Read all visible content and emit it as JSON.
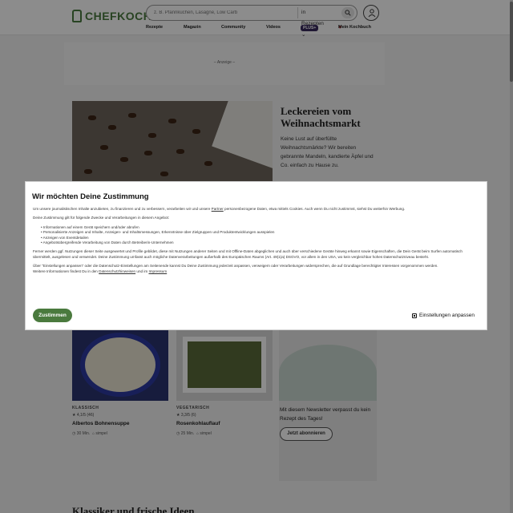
{
  "header": {
    "logo_text": "CHEFKOCH",
    "search_placeholder": "z. B. Pfannkuchen, Lasagne, Low Carb",
    "search_scope": "in Rezepten",
    "nav": {
      "recipes": "Rezepte",
      "magazine": "Magazin",
      "community": "Community",
      "videos": "Videos",
      "plus": "PLUS+",
      "cookbook": "Mein Kochbuch"
    }
  },
  "ad": {
    "label": "– Anzeige –"
  },
  "teaser": {
    "title": "Leckereien vom Weihnachtsmarkt",
    "text": "Keine Lust auf überfüllte Weihnachtsmärkte? Wir bereiten gebrannte Mandeln, kandierte Äpfel und Co. einfach zu Hause zu."
  },
  "cards": [
    {
      "category": "KLASSISCH",
      "rating": "★ 4,1/5 (46)",
      "title": "Albertos Bohnensuppe",
      "time": "30 Min.",
      "difficulty": "simpel"
    },
    {
      "category": "VEGETARISCH",
      "rating": "★ 3,3/5 (6)",
      "title": "Rosenkohlauflauf",
      "time": "25 Min.",
      "difficulty": "simpel"
    }
  ],
  "newsletter": {
    "text": "Mit diesem Newsletter verpasst du kein Rezept des Tages!",
    "button": "Jetzt abonnieren"
  },
  "bottom_heading": "Klassiker und frische Ideen",
  "consent": {
    "title": "Wir möchten Deine Zustimmung",
    "intro_before": "Um unsere journalistischen Inhalte anzubieten, zu finanzieren und zu verbessern, verarbeiten wir und unsere ",
    "intro_link": "Partner",
    "intro_after": " personenbezogene Daten, etwa mittels Cookies. Auch wenn Du nicht zustimmst, siehst Du weiterhin Werbung.",
    "purposes_intro": "Deine Zustimmung gilt für folgende Zwecke und Verarbeitungen in diesem Angebot:",
    "purposes": [
      "Informationen auf einem Gerät speichern und/oder abrufen",
      "Personalisierte Anzeigen und Inhalte, Anzeigen- und Inhaltsmessungen, Erkenntnisse über Zielgruppen und Produktentwicklungen ausspielen",
      "Anzeigen von Eventdetailen",
      "Angebotsübergreifende Verarbeitung von Daten durch Betreiberin-Unternehmen"
    ],
    "details": "Ferner werden ggf. Nutzungen dieser Seite ausgewertet und Profile gebildet, diese mit Nutzungen anderer Seiten und mit Offline-Daten abgeglichen und auch über verschiedene Geräte hinweg erkannt sowie Eigenschaften, die Dein Gerät beim Surfen automatisch übermittelt, ausgelesen und verwendet. Deine Zustimmung umfasst auch mögliche Datenverarbeitungen außerhalb des Europäischen Raums (Art. 49(1)a) DSGVO, vor allem in den USA, wo kein vergleichbar hohes Datenschutzniveau besteht.",
    "settings_note": "Über \"Einstellungen anpassen\" oder die Datenschutz-Einstellungen am Seitenende kannst Du Deine Zustimmung jederzeit anpassen, verweigern oder Verarbeitungen widersprechen, die auf Grundlage berechtigter Interessen vorgenommen werden.",
    "more_before": "Weitere Informationen findest Du in den ",
    "privacy_link": "Datenschutzhinweisen",
    "more_middle": " und im ",
    "imprint_link": "Impressum",
    "accept_button": "Zustimmen",
    "settings_button": "Einstellungen anpassen"
  },
  "colors": {
    "brand": "#4a7a3e",
    "overlay": "rgba(0,0,0,0.45)"
  }
}
